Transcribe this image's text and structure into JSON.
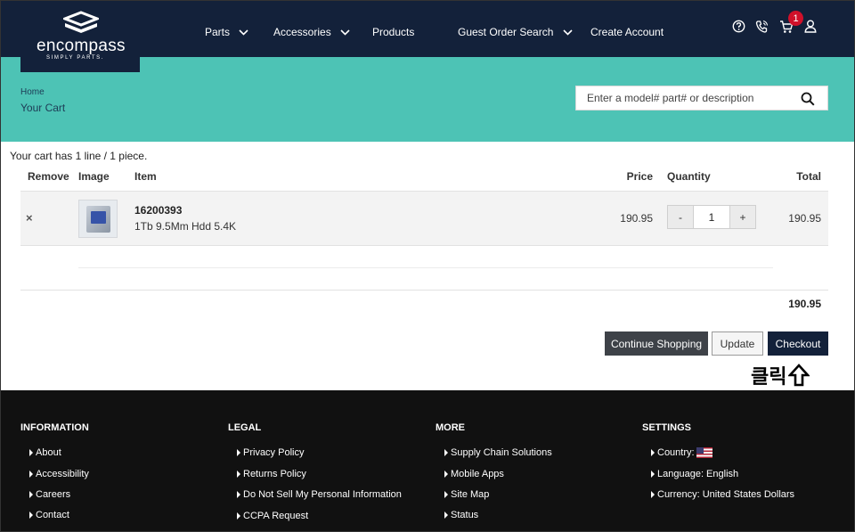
{
  "brand": {
    "name": "encompass",
    "tagline": "SIMPLY PARTS."
  },
  "nav": {
    "parts": "Parts",
    "accessories": "Accessories",
    "products": "Products",
    "guest_order_search": "Guest Order Search",
    "create_account": "Create Account"
  },
  "header_icons": [
    "help-icon",
    "phone-icon",
    "cart-icon",
    "user-icon"
  ],
  "cart_count": "1",
  "breadcrumb": {
    "home": "Home",
    "current": "Your Cart"
  },
  "search": {
    "placeholder": "Enter a model# part# or description"
  },
  "cart": {
    "summary": "Your cart has 1 line / 1 piece.",
    "columns": {
      "remove": "Remove",
      "image": "Image",
      "item": "Item",
      "price": "Price",
      "quantity": "Quantity",
      "total": "Total"
    },
    "items": [
      {
        "sku": "16200393",
        "description": "1Tb 9.5Mm Hdd 5.4K",
        "price": "190.95",
        "qty_minus": "-",
        "quantity": "1",
        "qty_plus": "+",
        "total": "190.95",
        "remove": "×"
      }
    ],
    "grand_total": "190.95"
  },
  "actions": {
    "continue": "Continue Shopping",
    "update": "Update",
    "checkout": "Checkout"
  },
  "annotation": {
    "text": "클릭"
  },
  "footer": {
    "information": {
      "title": "INFORMATION",
      "links": [
        "About",
        "Accessibility",
        "Careers",
        "Contact"
      ]
    },
    "legal": {
      "title": "LEGAL",
      "links": [
        "Privacy Policy",
        "Returns Policy",
        "Do Not Sell My Personal Information",
        "CCPA Request"
      ]
    },
    "more": {
      "title": "MORE",
      "links": [
        "Supply Chain Solutions",
        "Mobile Apps",
        "Site Map",
        "Status"
      ]
    },
    "settings": {
      "title": "SETTINGS",
      "country": "Country:",
      "language": "Language: English",
      "currency": "Currency: United States Dollars"
    }
  },
  "colors": {
    "navy": "#13213a",
    "teal": "#4dc3b5",
    "badge": "#d0102a",
    "footer": "#111111"
  }
}
